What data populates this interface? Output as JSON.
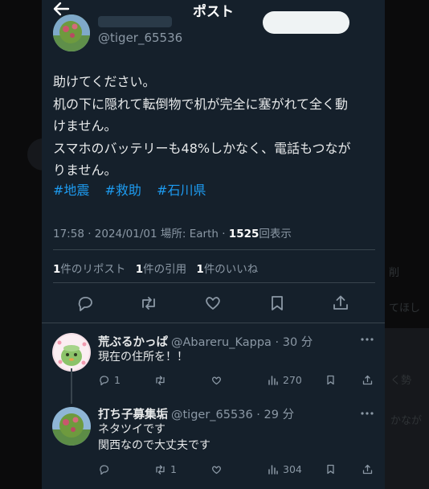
{
  "header": {
    "title": "ポスト"
  },
  "author": {
    "handle": "@tiger_65536"
  },
  "tweet": {
    "lines": [
      "助けてください。",
      "机の下に隠れて転倒物で机が完全に塞がれて全く動",
      "けません。",
      "スマホのバッテリーも48%しかなく、電話もつなが",
      "りません。"
    ],
    "hashtags": [
      "#地震",
      "#救助",
      "#石川県"
    ],
    "time": "17:58 · 2024/01/01 場所: Earth · ",
    "views_count": "1525",
    "views_label": "回表示"
  },
  "stats": {
    "reposts_count": "1",
    "reposts_label": "件のリポスト",
    "quotes_count": "1",
    "quotes_label": "件の引用",
    "likes_count": "1",
    "likes_label": "件のいいね"
  },
  "replies": [
    {
      "name": "荒ぶるかっぱ",
      "handle": "@Abareru_Kappa · 30 分",
      "text": [
        "現在の住所を！！"
      ],
      "reply_count": "1",
      "repost_count": "",
      "like_count": "",
      "views": "270"
    },
    {
      "name": "打ち子募集垢",
      "handle": "@tiger_65536 · 29 分",
      "text": [
        "ネタツイです",
        "関西なので大丈夫です"
      ],
      "reply_count": "",
      "repost_count": "1",
      "like_count": "",
      "views": "304"
    }
  ],
  "background": {
    "right_texts": [
      "削",
      "てほし",
      "く勢",
      "かなが"
    ]
  },
  "colors": {
    "panel_bg": "#15202b",
    "link": "#1d9bf0",
    "muted": "#8b98a5"
  },
  "icons": [
    "back-arrow-icon",
    "reply-icon",
    "repost-icon",
    "like-icon",
    "bookmark-icon",
    "share-icon",
    "views-icon",
    "more-icon"
  ]
}
